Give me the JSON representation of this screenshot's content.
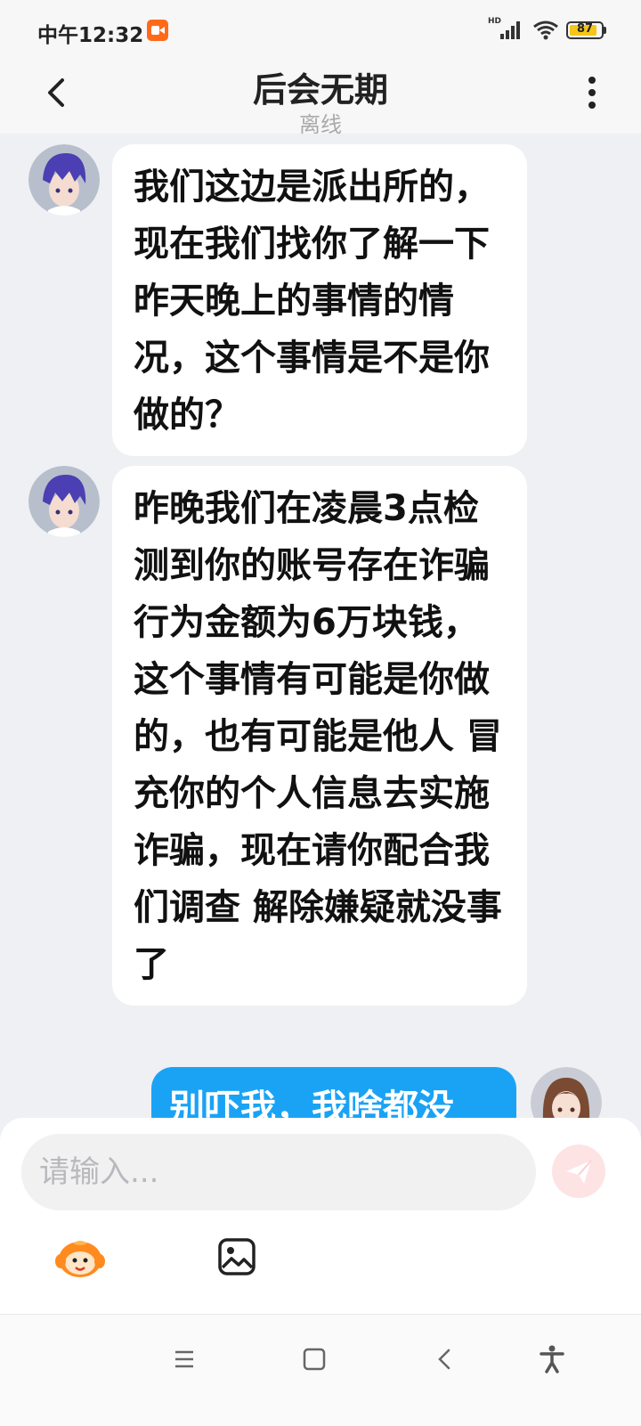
{
  "status_bar": {
    "time": "中午12:32",
    "network_label": "HD",
    "battery_level": 87
  },
  "header": {
    "title": "后会无期",
    "subtitle": "离线"
  },
  "messages": [
    {
      "sender": "other",
      "text": "我们这边是派出所的，现在我们找你了解一下昨天晚上的事情的情况，这个事情是不是你做的？"
    },
    {
      "sender": "other",
      "text": "昨晚我们在凌晨3点检测到你的账号存在诈骗  行为金额为6万块钱，这个事情有可能是你做的，也有可能是他人 冒充你的个人信息去实施诈骗，现在请你配合我们调查 解除嫌疑就没事了"
    },
    {
      "sender": "me",
      "text": "别吓我，我啥都没"
    }
  ],
  "input": {
    "placeholder": "请输入..."
  },
  "icons": {
    "back": "chevron-left-icon",
    "more": "more-vertical-icon",
    "send": "send-icon",
    "emoji": "emoji-mascot-icon",
    "image": "image-icon",
    "nav_menu": "menu-icon",
    "nav_home": "home-square-icon",
    "nav_back": "back-chevron-icon",
    "nav_accessibility": "accessibility-icon"
  },
  "colors": {
    "my_bubble": "#1aa3f5",
    "other_bubble": "#ffffff",
    "background": "#eef0f4",
    "record_badge": "#ff6a1a"
  }
}
